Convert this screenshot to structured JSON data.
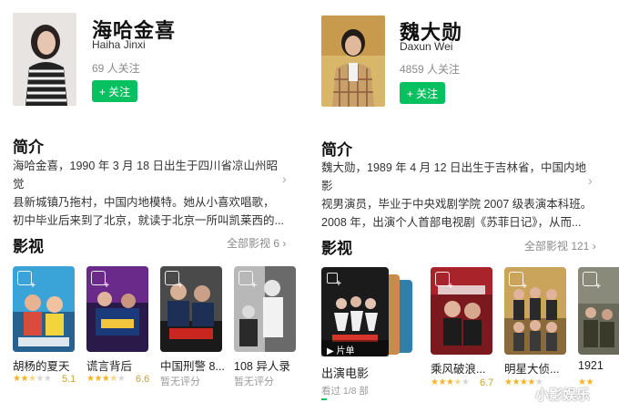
{
  "left": {
    "profile": {
      "name_cn": "海哈金喜",
      "name_en": "Haiha Jinxi",
      "followers": "69 人关注",
      "follow_label": "+ 关注"
    },
    "intro": {
      "title": "简介",
      "lines": [
        "海哈金喜，1990 年 3 月 18 日出生于四川省凉山州昭觉",
        "县新城镇乃拖村，中国内地模特。她从小喜欢唱歌，",
        "初中毕业后来到了北京，就读于北京一所叫凯莱西的..."
      ]
    },
    "films": {
      "title": "影视",
      "all_label": "全部影视 6",
      "items": [
        {
          "title": "胡杨的夏天",
          "rating": 2.5,
          "score": "5.1"
        },
        {
          "title": "谎言背后",
          "rating": 3.5,
          "score": "6.6"
        },
        {
          "title": "中国刑警 8...",
          "rating": 0,
          "score": "暂无评分"
        },
        {
          "title": "108 异人录",
          "rating": 0,
          "score": "暂无评分"
        }
      ]
    }
  },
  "right": {
    "profile": {
      "name_cn": "魏大勋",
      "name_en": "Daxun Wei",
      "followers": "4859 人关注",
      "follow_label": "+ 关注"
    },
    "intro": {
      "title": "简介",
      "lines": [
        "魏大勋，1989 年 4 月 12 日出生于吉林省，中国内地影",
        "视男演员，毕业于中央戏剧学院 2007 级表演本科班。",
        "2008 年，出演个人首部电视剧《苏菲日记》，从而..."
      ]
    },
    "films": {
      "title": "影视",
      "all_label": "全部影视 121",
      "playlist": {
        "title": "出演电影",
        "sub": "看过 1/8 部",
        "badge": "片单"
      },
      "items": [
        {
          "title": "乘风破浪...",
          "rating": 3.5,
          "score": "6.7"
        },
        {
          "title": "明星大侦...",
          "rating": 4,
          "score": ""
        },
        {
          "title": "1921",
          "rating": 0,
          "score": ""
        }
      ]
    }
  },
  "watermark": "小影娱乐",
  "colors": {
    "accent_green": "#07c160",
    "star": "#f5b326",
    "score": "#c9a233",
    "muted": "#8a8a8a"
  }
}
